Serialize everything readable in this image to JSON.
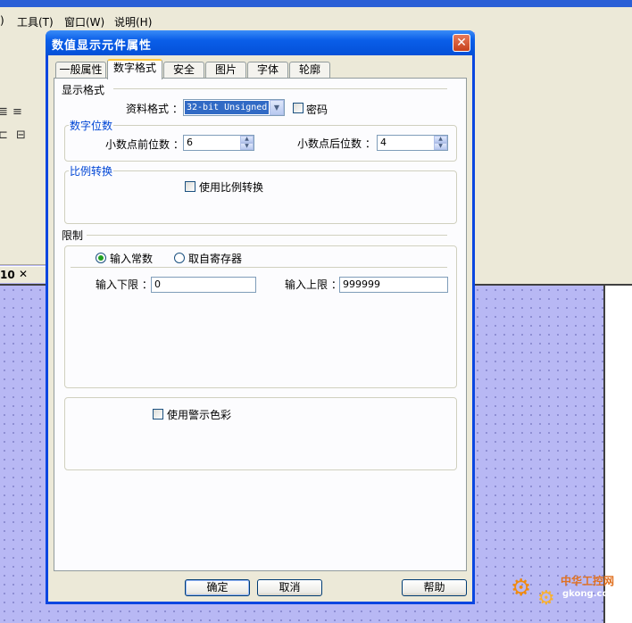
{
  "menubar": {
    "items": [
      ")",
      "工具(T)",
      "窗口(W)",
      "说明(H)"
    ]
  },
  "toolbar": {
    "icons": [
      "align-center-icon",
      "align-right-icon",
      "align-left-small-icon",
      "distribute-icon"
    ]
  },
  "document_tab": {
    "label": "10",
    "close": "✕"
  },
  "dialog": {
    "title": "数值显示元件属性",
    "close_glyph": "✕",
    "tabs": [
      {
        "label": "一般属性"
      },
      {
        "label": "数字格式",
        "active": true
      },
      {
        "label": "安全"
      },
      {
        "label": "图片"
      },
      {
        "label": "字体"
      },
      {
        "label": "轮廓"
      }
    ],
    "display_format": {
      "heading": "显示格式",
      "data_format_label": "资料格式 ：",
      "data_format_value": "32-bit Unsigned",
      "password_label": "密码",
      "password_checked": false
    },
    "digits": {
      "heading": "数字位数",
      "before_label": "小数点前位数 ：",
      "before_value": "6",
      "after_label": "小数点后位数 ：",
      "after_value": "4"
    },
    "scaling": {
      "heading": "比例转换",
      "use_label": "使用比例转换",
      "use_checked": false
    },
    "limits": {
      "heading": "限制",
      "radio_constant": "输入常数",
      "radio_register": "取自寄存器",
      "selected": "constant",
      "low_label": "输入下限 ：",
      "low_value": "0",
      "high_label": "输入上限 ：",
      "high_value": "999999"
    },
    "warning_color": {
      "label": "使用警示色彩",
      "checked": false
    },
    "buttons": {
      "ok": "确定",
      "cancel": "取消",
      "help": "帮助"
    }
  },
  "watermark": {
    "text": "中华工控网",
    "url": "gkong.com"
  }
}
